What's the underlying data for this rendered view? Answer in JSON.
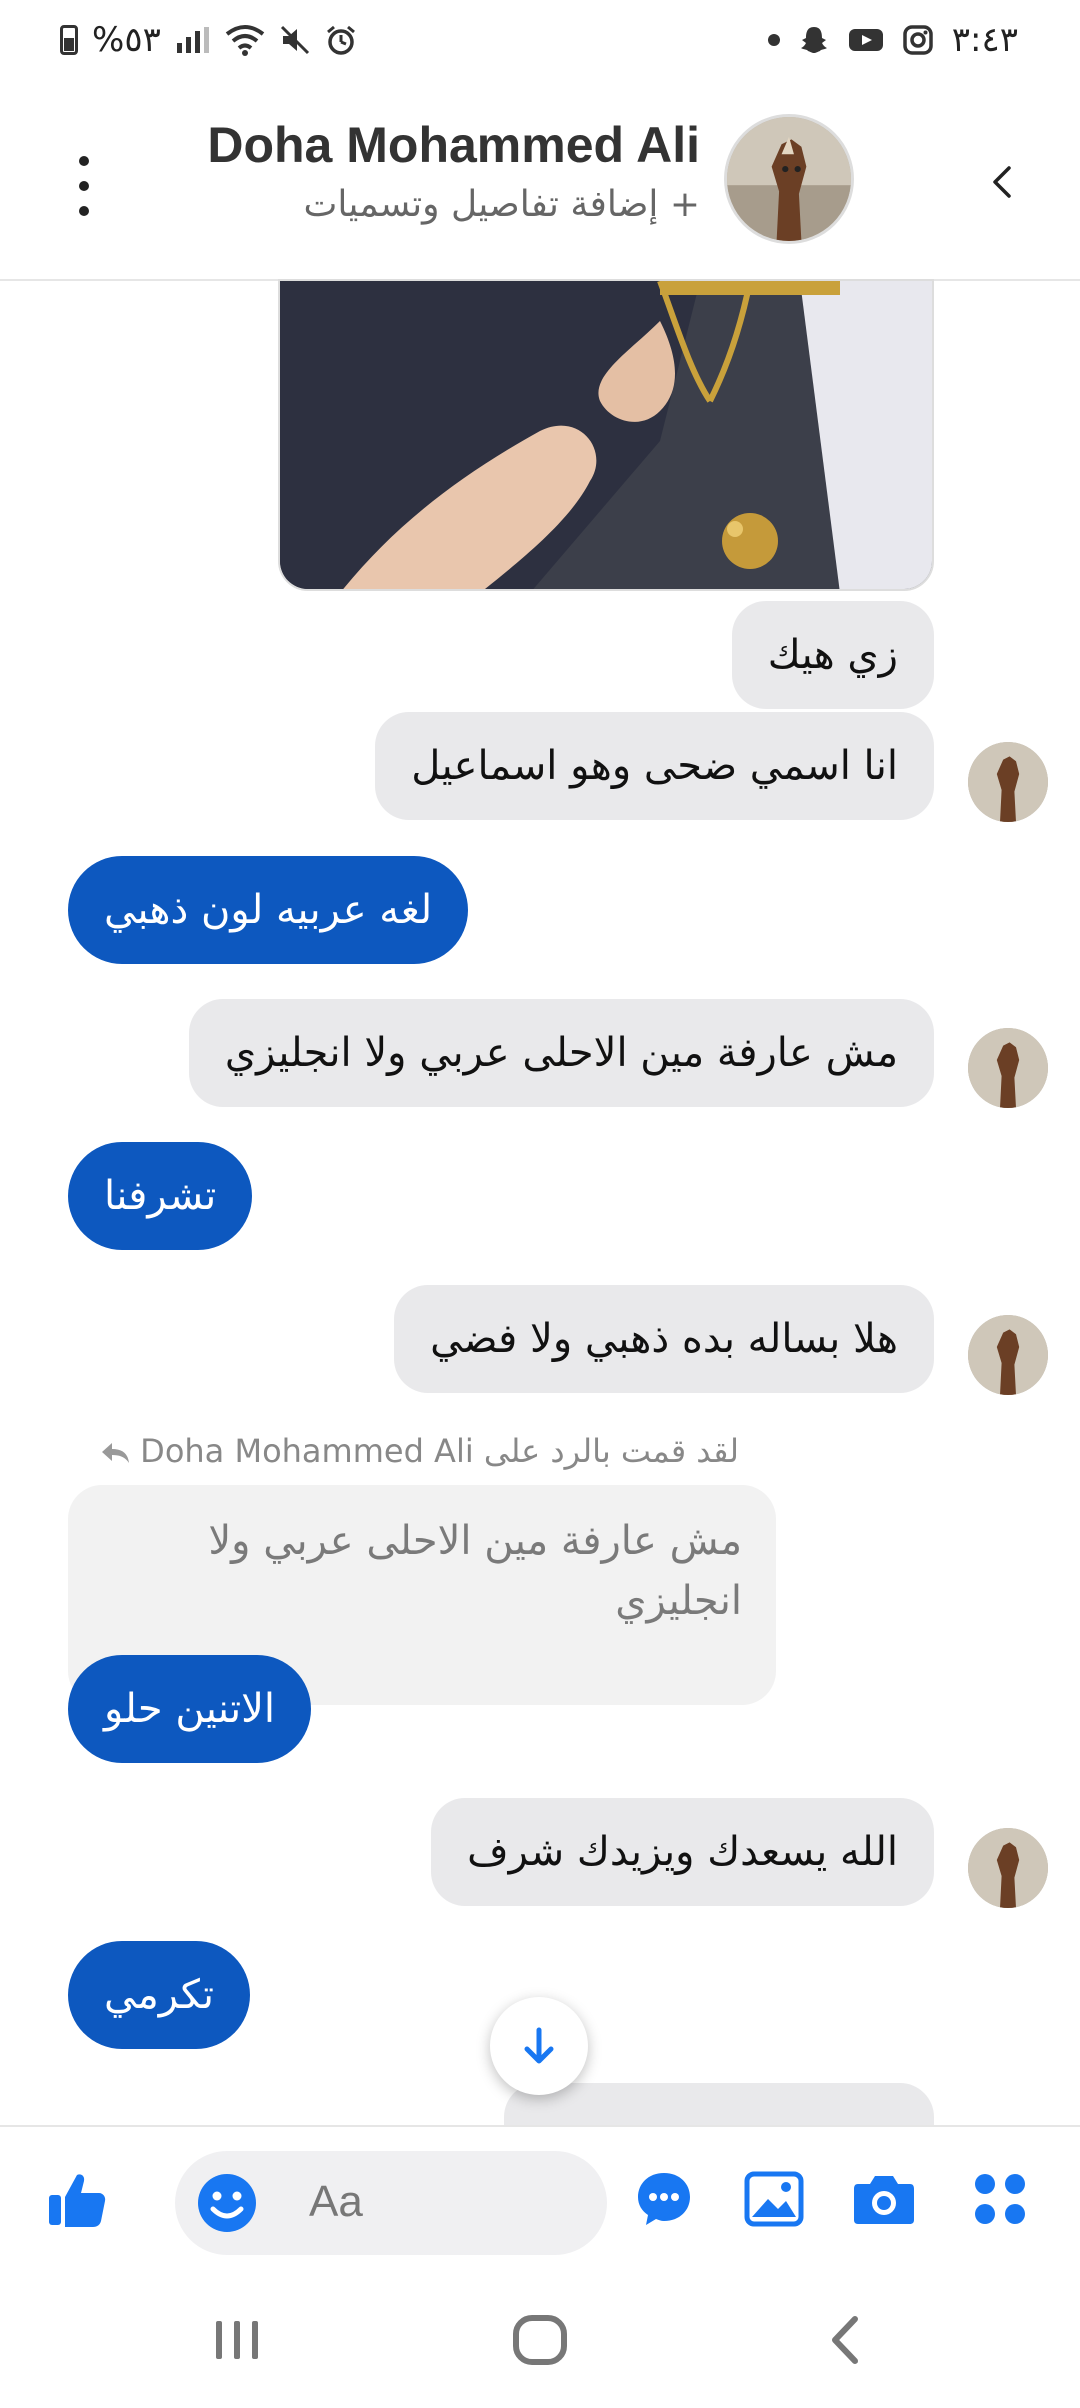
{
  "status_bar": {
    "battery": "%٥٣",
    "time": "٣:٤٣"
  },
  "header": {
    "contact_name": "Doha Mohammed Ali",
    "subtitle": "+ إضافة تفاصيل وتسميات"
  },
  "messages": [
    {
      "id": "m1",
      "dir": "in",
      "text": "زي هيك"
    },
    {
      "id": "m2",
      "dir": "in",
      "text": "انا اسمي ضحى وهو اسماعيل"
    },
    {
      "id": "m3",
      "dir": "out",
      "text": "لغه عربيه لون ذهبي"
    },
    {
      "id": "m4",
      "dir": "in",
      "text": "مش عارفة مين الاحلى عربي ولا انجليزي"
    },
    {
      "id": "m5",
      "dir": "out",
      "text": "تشرفنا"
    },
    {
      "id": "m6",
      "dir": "in",
      "text": "هلا بساله بده ذهبي ولا فضي"
    },
    {
      "id": "m7",
      "dir": "out",
      "text": "الاتنين حلو"
    },
    {
      "id": "m8",
      "dir": "in",
      "text": "الله يسعدك ويزيدك شرف"
    },
    {
      "id": "m9",
      "dir": "out",
      "text": "تكرمي"
    }
  ],
  "reply": {
    "label": "لقد قمت بالرد على Doha Mohammed Ali",
    "quoted_text": "مش عارفة مين الاحلى عربي ولا انجليزي"
  },
  "composer": {
    "placeholder": "Aa"
  },
  "colors": {
    "accent": "#1877f2",
    "outgoing_bubble": "#0d58bf",
    "incoming_bubble": "#e9e9eb"
  },
  "icons": [
    "thumbs-up-icon",
    "emoji-icon",
    "chat-bubble-icon",
    "image-icon",
    "camera-icon",
    "apps-grid-icon",
    "scroll-down-arrow-icon",
    "back-chevron-icon",
    "more-options-icon"
  ]
}
